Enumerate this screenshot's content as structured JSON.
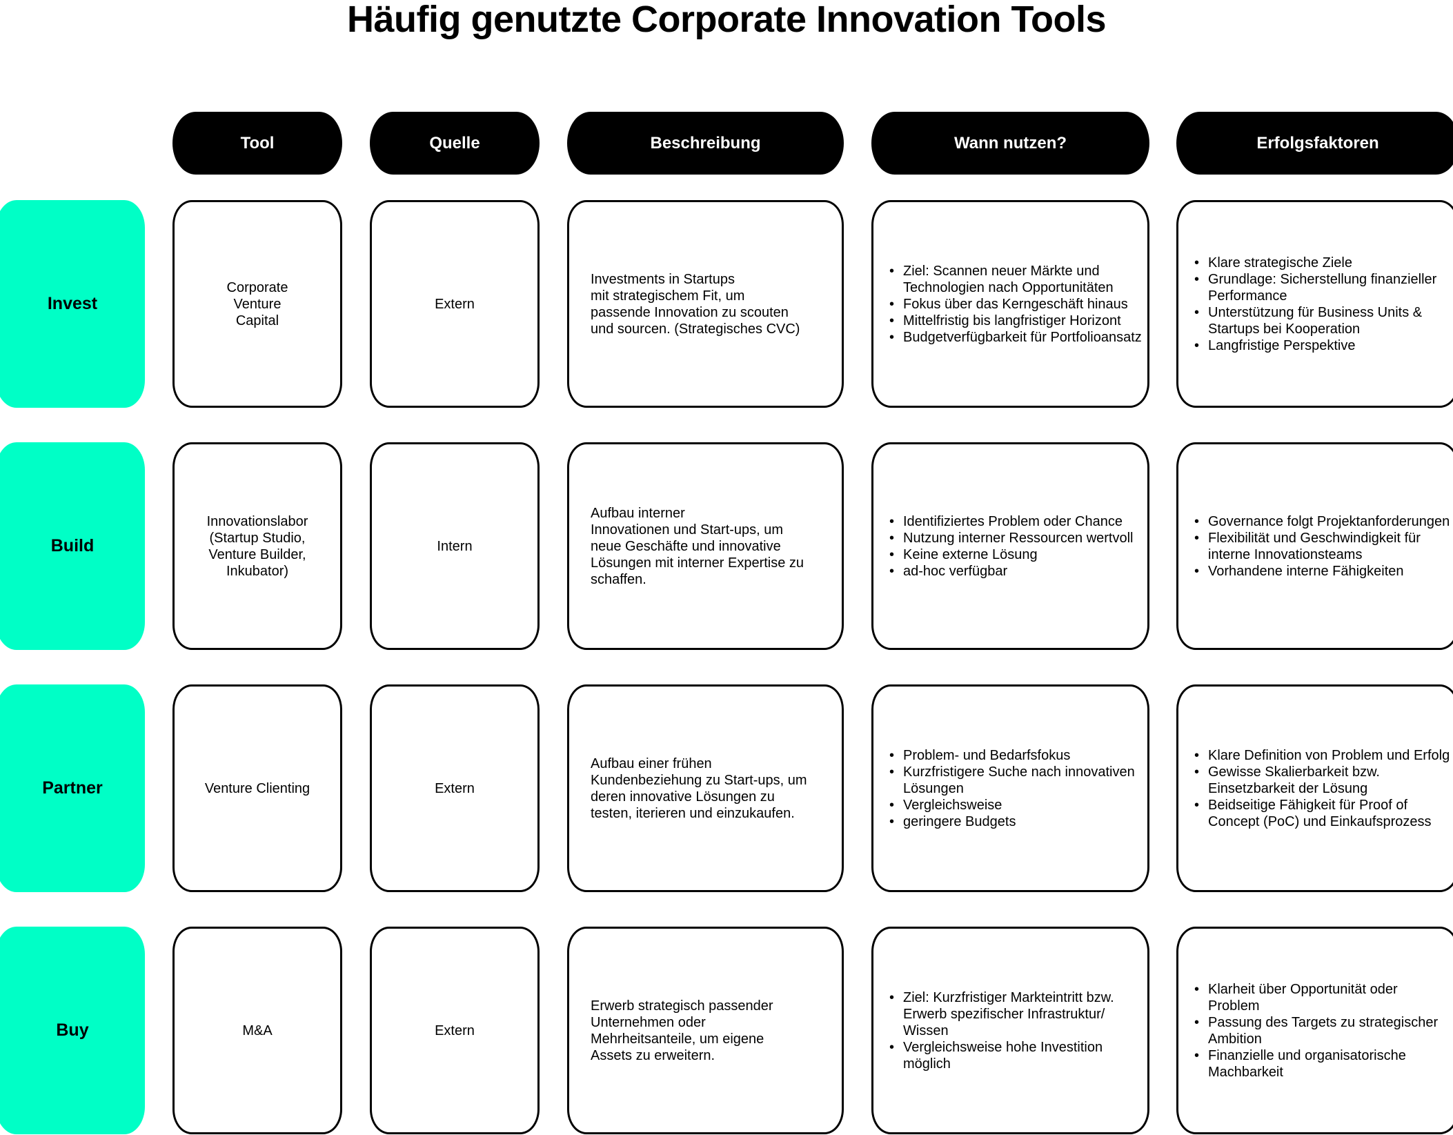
{
  "title": "Häufig genutzte Corporate Innovation Tools",
  "colors": {
    "accent": "#00FFC6",
    "header_bg": "#000000",
    "header_text": "#FFFFFF"
  },
  "headers": {
    "tool": "Tool",
    "quelle": "Quelle",
    "beschreibung": "Beschreibung",
    "wann": "Wann nutzen?",
    "erfolg": "Erfolgsfaktoren"
  },
  "rows": [
    {
      "label": "Invest",
      "tool": "Corporate\nVenture\nCapital",
      "quelle": "Extern",
      "beschreibung": "Investments in Startups\nmit strategischem Fit, um\npassende Innovation zu scouten\nund sourcen. (Strategisches CVC)",
      "wann": [
        "Ziel: Scannen neuer Märkte und Technologien nach Opportunitäten",
        "Fokus über das Kerngeschäft hinaus",
        "Mittelfristig bis langfristiger Horizont",
        "Budgetverfügbarkeit für Portfolioansatz"
      ],
      "erfolg": [
        "Klare strategische Ziele",
        "Grundlage: Sicherstellung finanzieller Performance",
        "Unterstützung für Business Units & Startups bei Kooperation",
        "Langfristige Perspektive"
      ]
    },
    {
      "label": "Build",
      "tool": "Innovationslabor\n(Startup Studio,\nVenture Builder,\nInkubator)",
      "quelle": "Intern",
      "beschreibung": "Aufbau interner\nInnovationen und Start-ups, um\nneue Geschäfte und innovative\nLösungen mit interner Expertise zu\nschaffen.",
      "wann": [
        "Identifiziertes Problem oder Chance",
        "Nutzung interner Ressourcen wertvoll",
        "Keine externe Lösung",
        "ad-hoc verfügbar"
      ],
      "erfolg": [
        "Governance folgt Projektanforderungen",
        "Flexibilität und Geschwindigkeit für interne Innovationsteams",
        "Vorhandene interne Fähigkeiten"
      ]
    },
    {
      "label": "Partner",
      "tool": "Venture Clienting",
      "quelle": "Extern",
      "beschreibung": "Aufbau einer frühen\nKundenbeziehung zu Start-ups, um\nderen innovative Lösungen zu\ntesten, iterieren und einzukaufen.",
      "wann": [
        "Problem- und Bedarfsfokus",
        "Kurzfristigere Suche nach innovativen Lösungen",
        "Vergleichsweise",
        "geringere Budgets"
      ],
      "erfolg": [
        "Klare Definition von Problem und Erfolg",
        "Gewisse Skalierbarkeit bzw. Einsetzbarkeit der Lösung",
        "Beidseitige Fähigkeit für Proof of Concept (PoC) und Einkaufsprozess"
      ]
    },
    {
      "label": "Buy",
      "tool": "M&A",
      "quelle": "Extern",
      "beschreibung": "Erwerb strategisch passender\nUnternehmen oder\nMehrheitsanteile, um eigene\nAssets zu erweitern.",
      "wann": [
        "Ziel: Kurzfristiger Markteintritt bzw. Erwerb spezifischer Infrastruktur/ Wissen",
        "Vergleichsweise hohe Investition möglich"
      ],
      "erfolg": [
        "Klarheit über Opportunität oder Problem",
        "Passung des Targets zu strategischer Ambition",
        "Finanzielle und organisatorische Machbarkeit"
      ]
    }
  ],
  "bullet_glyph": "•"
}
